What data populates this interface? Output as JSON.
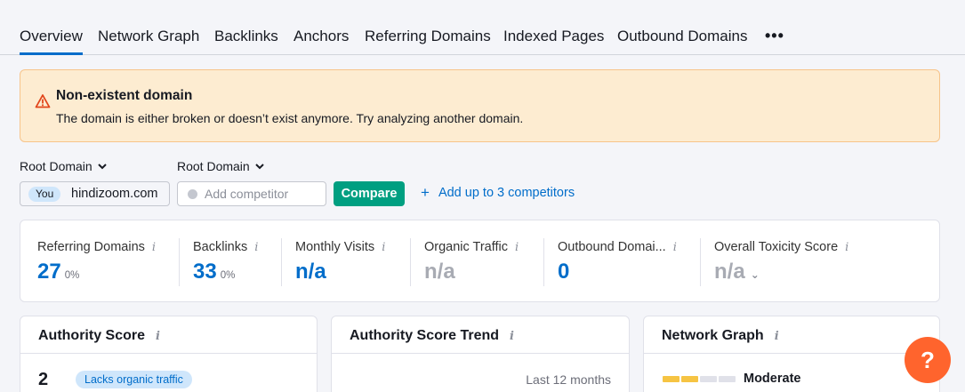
{
  "tabs": [
    {
      "label": "Overview",
      "active": true
    },
    {
      "label": "Network Graph"
    },
    {
      "label": "Backlinks"
    },
    {
      "label": "Anchors"
    },
    {
      "label": "Referring Domains"
    },
    {
      "label": "Indexed Pages"
    },
    {
      "label": "Outbound Domains"
    }
  ],
  "more_label": "•••",
  "warning": {
    "title": "Non-existent domain",
    "text": "The domain is either broken or doesn’t exist anymore. Try analyzing another domain."
  },
  "controls": {
    "scope_1": "Root Domain",
    "scope_2": "Root Domain",
    "you_badge": "You",
    "domain": "hindizoom.com",
    "competitor_placeholder": "Add competitor",
    "compare_label": "Compare",
    "add_competitors_label": "Add up to 3 competitors"
  },
  "metrics": [
    {
      "label": "Referring Domains",
      "value": "27",
      "change": "0%"
    },
    {
      "label": "Backlinks",
      "value": "33",
      "change": "0%"
    },
    {
      "label": "Monthly Visits",
      "value": "n/a",
      "change": ""
    },
    {
      "label": "Organic Traffic",
      "value": "n/a",
      "change": ""
    },
    {
      "label": "Outbound Domai...",
      "value": "0",
      "change": ""
    },
    {
      "label": "Overall Toxicity Score",
      "value": "n/a",
      "change": ""
    }
  ],
  "cards": {
    "authority": {
      "title": "Authority Score",
      "value": "2",
      "badge": "Lacks organic traffic"
    },
    "trend": {
      "title": "Authority Score Trend",
      "period": "Last 12 months"
    },
    "network": {
      "title": "Network Graph",
      "level": "Moderate"
    }
  },
  "help_label": "?",
  "colors": {
    "accent": "#006dca",
    "compare": "#009f81",
    "warning_bg": "#fdecd1",
    "help": "#ff642d",
    "ng_filled": "#f6c443",
    "ng_empty": "#e0e1e9"
  },
  "icons": {
    "warning": "warning-triangle-icon",
    "chevron": "chevron-down-icon",
    "info": "info-icon",
    "plus": "plus-icon"
  }
}
